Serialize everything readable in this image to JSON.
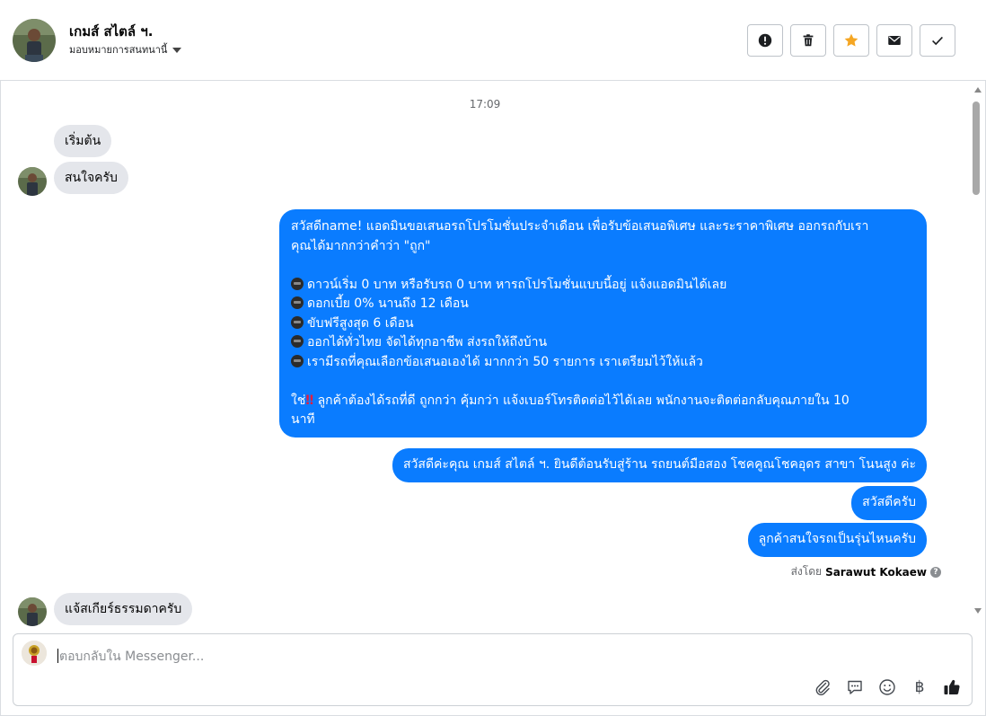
{
  "header": {
    "contact_name": "เกมส์ สไตล์ ฯ.",
    "assign_label": "มอบหมายการสนทนานี้",
    "actions": [
      {
        "name": "report-button",
        "icon": "exclamation-circle-icon"
      },
      {
        "name": "delete-button",
        "icon": "trash-icon"
      },
      {
        "name": "star-button",
        "icon": "star-icon",
        "color": "#f5a623"
      },
      {
        "name": "mark-unread-button",
        "icon": "envelope-icon"
      },
      {
        "name": "mark-done-button",
        "icon": "checkmark-icon"
      }
    ]
  },
  "chat": {
    "timestamp": "17:09",
    "incoming": [
      {
        "text": "เริ่มต้น"
      },
      {
        "text": "สนใจครับ"
      },
      {
        "text": "แจ้สเกียร์ธรรมดาครับ"
      }
    ],
    "promo": {
      "line1": "สวัสดีname! แอดมินขอเสนอรถโปรโมชั่นประจำเดือน เพื่อรับข้อเสนอพิเศษ และระราคาพิเศษ ออกรถกับเรา",
      "line2": "คุณได้มากกว่าคำว่า \"ถูก\"",
      "bullets": [
        "ดาวน์เริ่ม 0 บาท หรือรับรถ 0 บาท หารถโปรโมชั่นแบบนี้อยู่ แจ้งแอดมินได้เลย",
        "ดอกเบี้ย 0% นานถึง 12 เดือน",
        "ขับฟรีสูงสุด 6 เดือน",
        "ออกได้ทั่วไทย จัดได้ทุกอาชีพ ส่งรถให้ถึงบ้าน",
        "เรามีรถที่คุณเลือกข้อเสนอเองได้ มากกว่า 50 รายการ เราเตรียมไว้ให้แล้ว"
      ],
      "closing_prefix": "ใช่",
      "closing_bang": "‼",
      "closing_rest": "ลูกค้าต้องได้รถที่ดี ถูกกว่า คุ้มกว่า แจ้งเบอร์โทรติดต่อไว้ได้เลย พนักงานจะติดต่อกลับคุณภายใน 10",
      "closing_tail": "นาที"
    },
    "outgoing": [
      {
        "text": "สวัสดีค่ะคุณ เกมส์ สไตล์ ฯ. ยินดีต้อนรับสู่ร้าน รถยนต์มือสอง โชคคูณโชคอุดร สาขา โนนสูง ค่ะ"
      },
      {
        "text": "สวัสดีครับ"
      },
      {
        "text": "ลูกค้าสนใจรถเป็นรุ่นไหนครับ"
      }
    ],
    "sent_by_label": "ส่งโดย",
    "sent_by_name": "Sarawut Kokaew",
    "help_icon": "question-circle-icon",
    "outgoing_color": "#0a7cff",
    "incoming_color": "#e4e6eb"
  },
  "composer": {
    "placeholder": "ตอบกลับใน Messenger...",
    "tools": [
      "paperclip-icon",
      "saved-reply-icon",
      "emoji-icon",
      "baht-icon",
      "thumbs-up-icon"
    ],
    "baht_symbol": "฿"
  }
}
